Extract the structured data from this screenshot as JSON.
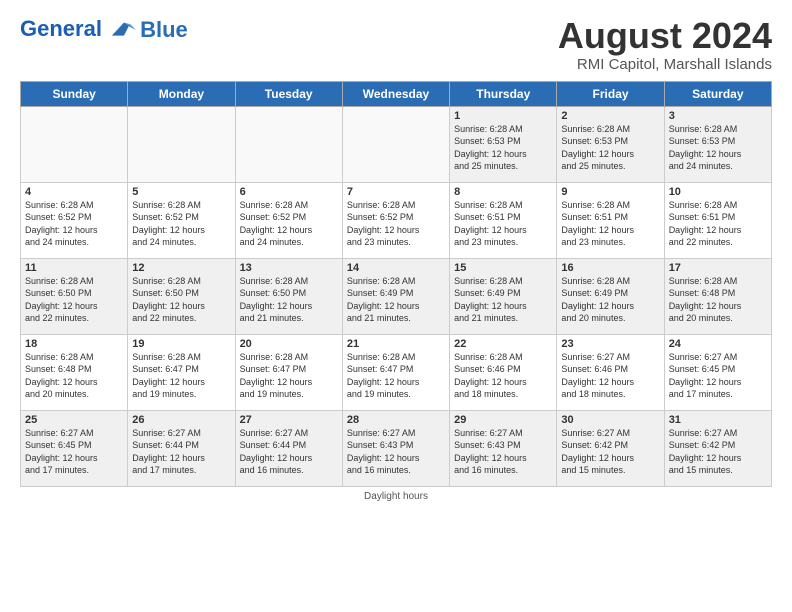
{
  "header": {
    "logo_line1": "General",
    "logo_line2": "Blue",
    "title": "August 2024",
    "subtitle": "RMI Capitol, Marshall Islands"
  },
  "days_of_week": [
    "Sunday",
    "Monday",
    "Tuesday",
    "Wednesday",
    "Thursday",
    "Friday",
    "Saturday"
  ],
  "weeks": [
    [
      {
        "day": "",
        "info": ""
      },
      {
        "day": "",
        "info": ""
      },
      {
        "day": "",
        "info": ""
      },
      {
        "day": "",
        "info": ""
      },
      {
        "day": "1",
        "info": "Sunrise: 6:28 AM\nSunset: 6:53 PM\nDaylight: 12 hours\nand 25 minutes."
      },
      {
        "day": "2",
        "info": "Sunrise: 6:28 AM\nSunset: 6:53 PM\nDaylight: 12 hours\nand 25 minutes."
      },
      {
        "day": "3",
        "info": "Sunrise: 6:28 AM\nSunset: 6:53 PM\nDaylight: 12 hours\nand 24 minutes."
      }
    ],
    [
      {
        "day": "4",
        "info": "Sunrise: 6:28 AM\nSunset: 6:52 PM\nDaylight: 12 hours\nand 24 minutes."
      },
      {
        "day": "5",
        "info": "Sunrise: 6:28 AM\nSunset: 6:52 PM\nDaylight: 12 hours\nand 24 minutes."
      },
      {
        "day": "6",
        "info": "Sunrise: 6:28 AM\nSunset: 6:52 PM\nDaylight: 12 hours\nand 24 minutes."
      },
      {
        "day": "7",
        "info": "Sunrise: 6:28 AM\nSunset: 6:52 PM\nDaylight: 12 hours\nand 23 minutes."
      },
      {
        "day": "8",
        "info": "Sunrise: 6:28 AM\nSunset: 6:51 PM\nDaylight: 12 hours\nand 23 minutes."
      },
      {
        "day": "9",
        "info": "Sunrise: 6:28 AM\nSunset: 6:51 PM\nDaylight: 12 hours\nand 23 minutes."
      },
      {
        "day": "10",
        "info": "Sunrise: 6:28 AM\nSunset: 6:51 PM\nDaylight: 12 hours\nand 22 minutes."
      }
    ],
    [
      {
        "day": "11",
        "info": "Sunrise: 6:28 AM\nSunset: 6:50 PM\nDaylight: 12 hours\nand 22 minutes."
      },
      {
        "day": "12",
        "info": "Sunrise: 6:28 AM\nSunset: 6:50 PM\nDaylight: 12 hours\nand 22 minutes."
      },
      {
        "day": "13",
        "info": "Sunrise: 6:28 AM\nSunset: 6:50 PM\nDaylight: 12 hours\nand 21 minutes."
      },
      {
        "day": "14",
        "info": "Sunrise: 6:28 AM\nSunset: 6:49 PM\nDaylight: 12 hours\nand 21 minutes."
      },
      {
        "day": "15",
        "info": "Sunrise: 6:28 AM\nSunset: 6:49 PM\nDaylight: 12 hours\nand 21 minutes."
      },
      {
        "day": "16",
        "info": "Sunrise: 6:28 AM\nSunset: 6:49 PM\nDaylight: 12 hours\nand 20 minutes."
      },
      {
        "day": "17",
        "info": "Sunrise: 6:28 AM\nSunset: 6:48 PM\nDaylight: 12 hours\nand 20 minutes."
      }
    ],
    [
      {
        "day": "18",
        "info": "Sunrise: 6:28 AM\nSunset: 6:48 PM\nDaylight: 12 hours\nand 20 minutes."
      },
      {
        "day": "19",
        "info": "Sunrise: 6:28 AM\nSunset: 6:47 PM\nDaylight: 12 hours\nand 19 minutes."
      },
      {
        "day": "20",
        "info": "Sunrise: 6:28 AM\nSunset: 6:47 PM\nDaylight: 12 hours\nand 19 minutes."
      },
      {
        "day": "21",
        "info": "Sunrise: 6:28 AM\nSunset: 6:47 PM\nDaylight: 12 hours\nand 19 minutes."
      },
      {
        "day": "22",
        "info": "Sunrise: 6:28 AM\nSunset: 6:46 PM\nDaylight: 12 hours\nand 18 minutes."
      },
      {
        "day": "23",
        "info": "Sunrise: 6:27 AM\nSunset: 6:46 PM\nDaylight: 12 hours\nand 18 minutes."
      },
      {
        "day": "24",
        "info": "Sunrise: 6:27 AM\nSunset: 6:45 PM\nDaylight: 12 hours\nand 17 minutes."
      }
    ],
    [
      {
        "day": "25",
        "info": "Sunrise: 6:27 AM\nSunset: 6:45 PM\nDaylight: 12 hours\nand 17 minutes."
      },
      {
        "day": "26",
        "info": "Sunrise: 6:27 AM\nSunset: 6:44 PM\nDaylight: 12 hours\nand 17 minutes."
      },
      {
        "day": "27",
        "info": "Sunrise: 6:27 AM\nSunset: 6:44 PM\nDaylight: 12 hours\nand 16 minutes."
      },
      {
        "day": "28",
        "info": "Sunrise: 6:27 AM\nSunset: 6:43 PM\nDaylight: 12 hours\nand 16 minutes."
      },
      {
        "day": "29",
        "info": "Sunrise: 6:27 AM\nSunset: 6:43 PM\nDaylight: 12 hours\nand 16 minutes."
      },
      {
        "day": "30",
        "info": "Sunrise: 6:27 AM\nSunset: 6:42 PM\nDaylight: 12 hours\nand 15 minutes."
      },
      {
        "day": "31",
        "info": "Sunrise: 6:27 AM\nSunset: 6:42 PM\nDaylight: 12 hours\nand 15 minutes."
      }
    ]
  ],
  "footer": "Daylight hours"
}
